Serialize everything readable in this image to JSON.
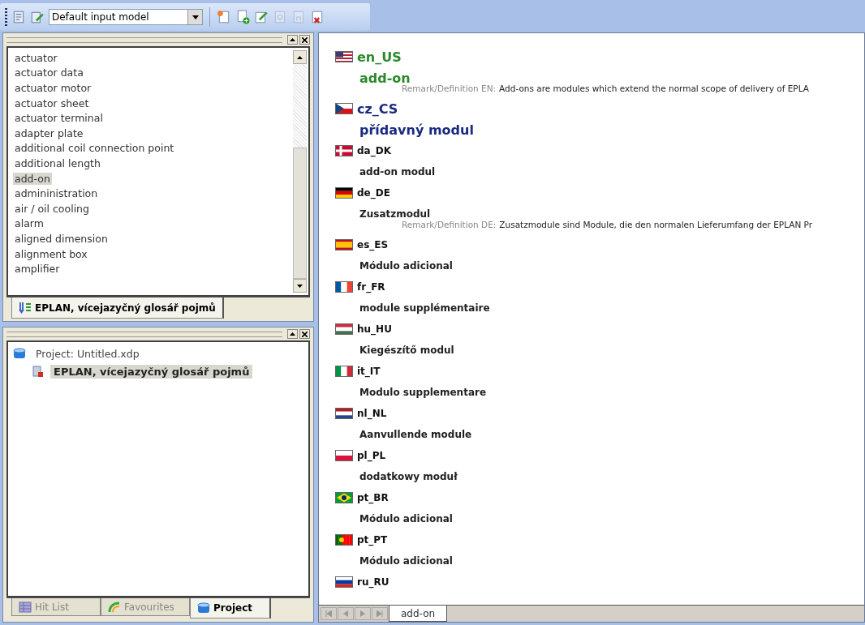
{
  "toolbar": {
    "model_select": {
      "value": "Default input model"
    }
  },
  "glossary_panel": {
    "items": [
      {
        "label": "actuator",
        "selected": false
      },
      {
        "label": "actuator data",
        "selected": false
      },
      {
        "label": "actuator motor",
        "selected": false
      },
      {
        "label": "actuator sheet",
        "selected": false
      },
      {
        "label": "actuator terminal",
        "selected": false
      },
      {
        "label": "adapter plate",
        "selected": false
      },
      {
        "label": "additional coil connection point",
        "selected": false
      },
      {
        "label": "additional length",
        "selected": false
      },
      {
        "label": "add-on",
        "selected": true
      },
      {
        "label": "admininistration",
        "selected": false
      },
      {
        "label": "air / oil cooling",
        "selected": false
      },
      {
        "label": "alarm",
        "selected": false
      },
      {
        "label": "aligned dimension",
        "selected": false
      },
      {
        "label": "alignment box",
        "selected": false
      },
      {
        "label": "amplifier",
        "selected": false
      }
    ],
    "tab": {
      "label": "EPLAN, vícejazyčný glosář pojmů",
      "selected": true
    }
  },
  "project_panel": {
    "tree": [
      {
        "label": "Project: Untitled.xdp",
        "children": [
          {
            "label": "EPLAN, vícejazyčný glosář pojmů",
            "selected": true
          }
        ]
      }
    ],
    "tabs": [
      {
        "label": "Hit List",
        "selected": false
      },
      {
        "label": "Favourites",
        "selected": false
      },
      {
        "label": "Project",
        "selected": true
      }
    ]
  },
  "content": {
    "entries": [
      {
        "locale": "en_US",
        "term": "add-on",
        "kind": "source",
        "remark_label": "Remark/Definition EN:",
        "remark": "Add-ons are modules which extend the normal scope of delivery of EPLA"
      },
      {
        "locale": "cz_CS",
        "term": "přídavný modul",
        "kind": "target"
      },
      {
        "locale": "da_DK",
        "term": "add-on modul",
        "kind": "other"
      },
      {
        "locale": "de_DE",
        "term": "Zusatzmodul",
        "kind": "other",
        "remark_label": "Remark/Definition DE:",
        "remark": "Zusatzmodule sind Module, die den normalen Lieferumfang der EPLAN Pr"
      },
      {
        "locale": "es_ES",
        "term": "Módulo adicional",
        "kind": "other"
      },
      {
        "locale": "fr_FR",
        "term": "module supplémentaire",
        "kind": "other"
      },
      {
        "locale": "hu_HU",
        "term": "Kiegészítő modul",
        "kind": "other"
      },
      {
        "locale": "it_IT",
        "term": "Modulo supplementare",
        "kind": "other"
      },
      {
        "locale": "nl_NL",
        "term": "Aanvullende module",
        "kind": "other"
      },
      {
        "locale": "pl_PL",
        "term": "dodatkowy moduł",
        "kind": "other"
      },
      {
        "locale": "pt_BR",
        "term": "Módulo adicional",
        "kind": "other"
      },
      {
        "locale": "pt_PT",
        "term": "Módulo adicional",
        "kind": "other"
      },
      {
        "locale": "ru_RU",
        "kind": "other"
      }
    ],
    "sheet_tabs": [
      {
        "label": "add-on",
        "selected": true
      }
    ]
  }
}
